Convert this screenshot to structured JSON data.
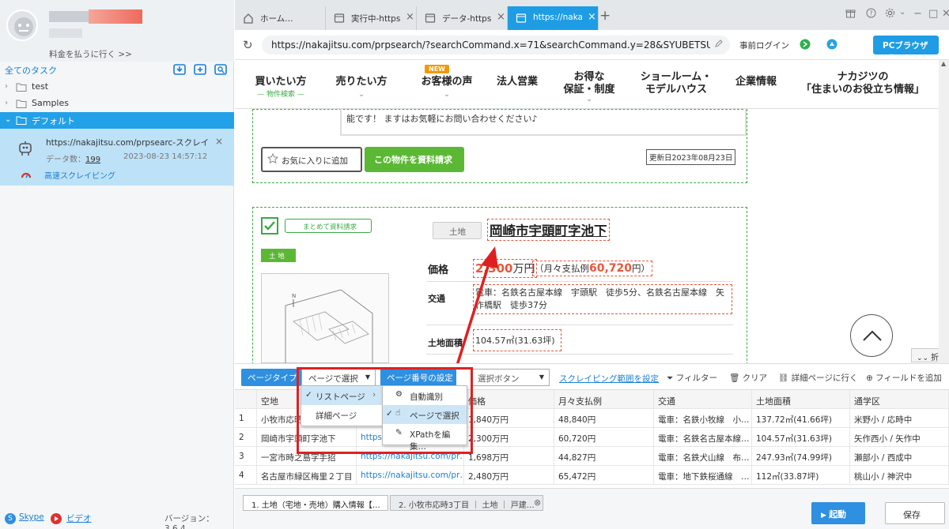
{
  "sidebar": {
    "pay_link": "料金を払うに行く >>",
    "all_tasks": "全てのタスク",
    "tree": [
      {
        "name": "test",
        "expanded": false
      },
      {
        "name": "Samples",
        "expanded": false
      },
      {
        "name": "デフォルト",
        "expanded": true
      }
    ],
    "task": {
      "url": "https://nakajitsu.com/prpsearc-スクレイピング",
      "data_label": "データ数：",
      "data_count": "199",
      "date": "2023-08-23 14:57:12",
      "speed": "高速スクレイピング"
    },
    "footer": {
      "skype": "Skype",
      "video": "ビデオ",
      "version": "バージョン：3.6.4"
    }
  },
  "browser": {
    "tabs": [
      {
        "label": "ホーム…",
        "icon": "home-icon",
        "active": false
      },
      {
        "label": "実行中-https…",
        "icon": "page-icon",
        "active": false
      },
      {
        "label": "データ-https…",
        "icon": "page-icon",
        "active": false
      },
      {
        "label": "https://naka…",
        "icon": "page-icon",
        "active": true
      }
    ],
    "url": "https://nakajitsu.com/prpsearch/?searchCommand.x=71&searchCommand.y=28&SYUBETSU…",
    "login": "事前ログイン",
    "pc_browser": "PCブラウザ"
  },
  "site": {
    "nav": [
      {
        "label": "買いたい方",
        "sub": "— 物件検索 —"
      },
      {
        "label": "売りたい方"
      },
      {
        "label": "お客様の声",
        "badge": "NEW"
      },
      {
        "label": "法人営業"
      },
      {
        "label": "お得な\n保証・制度"
      },
      {
        "label": "ショールーム・\nモデルハウス"
      },
      {
        "label": "企業情報"
      },
      {
        "label": "ナカジツの\n「住まいのお役立ち情報」"
      }
    ],
    "prev_card": {
      "tail_text": "能です！ ますはお気軽にお問い合わせください♪",
      "fav": "お気に入りに追加",
      "request": "この物件を資料請求",
      "updated": "更新日2023年08月23日"
    },
    "card": {
      "bulk": "まとめて資料請求",
      "badge": "土 地",
      "tag": "土地",
      "title": "岡崎市宇頭町字池下",
      "price_label": "価格",
      "price": "2,300",
      "price_unit": "万円",
      "monthly_pre": "（月々支払例",
      "monthly": "60,720",
      "monthly_post": "円）",
      "access_label": "交通",
      "access": "電車：名鉄名古屋本線　宇頭駅　徒歩5分、名鉄名古屋本線　矢作橋駅　徒歩37分",
      "area_label": "土地面積",
      "area": "104.57㎡(31.63坪)"
    },
    "fold": "折る"
  },
  "toolbar": {
    "page_type": "ページタイプ",
    "page_select": "ページで選択",
    "page_number": "ページ番号の設定",
    "select_button": "選択ボタン",
    "range": "スクレイピング範囲を設定",
    "filter": "フィルター",
    "clear": "クリア",
    "detail": "詳細ページに行く",
    "add_field": "フィールドを追加"
  },
  "menu1": [
    {
      "label": "リストページ",
      "checked": true
    },
    {
      "label": "詳細ページ",
      "checked": false
    }
  ],
  "menu2": [
    {
      "label": "自動識別",
      "checked": false
    },
    {
      "label": "ページで選択",
      "checked": true
    },
    {
      "label": "XPathを編集…",
      "checked": false
    }
  ],
  "grid": {
    "headers": [
      "",
      "空地",
      "",
      "価格",
      "月々支払例",
      "交通",
      "土地面積",
      "通学区"
    ],
    "rows": [
      [
        "1",
        "小牧市応時",
        "",
        "1,840万円",
        "48,840円",
        "電車：名鉄小牧線　小…",
        "137.72㎡(41.66坪)",
        "米野小 / 応時中"
      ],
      [
        "2",
        "岡崎市宇頭町字池下",
        "https…",
        "2,300万円",
        "60,720円",
        "電車：名鉄名古屋本線…",
        "104.57㎡(31.63坪)",
        "矢作西小 / 矢作中"
      ],
      [
        "3",
        "一宮市時之島字手招",
        "https://nakajitsu.com/pr…",
        "1,698万円",
        "44,827円",
        "電車：名鉄犬山線　布…",
        "247.93㎡(74.99坪)",
        "瀬部小 / 西成中"
      ],
      [
        "4",
        "名古屋市緑区梅里２丁目",
        "https://nakajitsu.com/pr…",
        "2,480万円",
        "65,472円",
        "電車：地下鉄桜通線　…",
        "112㎡(33.87坪)",
        "桃山小 / 神沢中"
      ]
    ]
  },
  "bottom": {
    "tabs": [
      "1. 土地（宅地・売地）購入情報【…",
      "2. 小牧市応時3丁目 ｜ 土地 ｜ 戸建…"
    ],
    "run": "起動",
    "save": "保存"
  }
}
